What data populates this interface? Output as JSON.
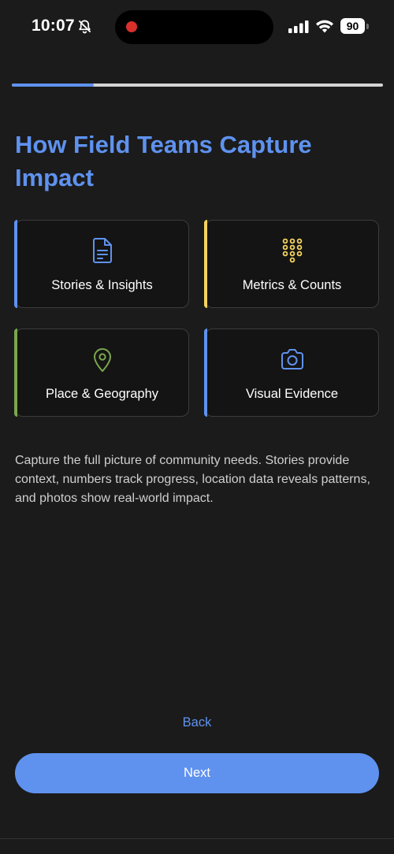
{
  "status_bar": {
    "time": "10:07",
    "battery": "90",
    "icons": [
      "bell-slash-icon",
      "signal-icon",
      "wifi-icon",
      "battery-icon"
    ]
  },
  "progress": {
    "fraction": 0.22,
    "fill_color": "#5f92ef",
    "track_color": "#d4d4d4"
  },
  "title": "How Field Teams Capture Impact",
  "cards": [
    {
      "label": "Stories & Insights",
      "icon": "document-icon",
      "accent": "#5f92ef"
    },
    {
      "label": "Metrics & Counts",
      "icon": "keypad-icon",
      "accent": "#f4d35e"
    },
    {
      "label": "Place & Geography",
      "icon": "map-pin-icon",
      "accent": "#7aa64e"
    },
    {
      "label": "Visual Evidence",
      "icon": "camera-icon",
      "accent": "#5f92ef"
    }
  ],
  "description": "Capture the full picture of community needs. Stories provide context, numbers track progress, location data reveals patterns, and photos show real-world impact.",
  "actions": {
    "back_label": "Back",
    "next_label": "Next"
  },
  "colors": {
    "background": "#1b1b1b",
    "accent": "#5f92ef"
  }
}
